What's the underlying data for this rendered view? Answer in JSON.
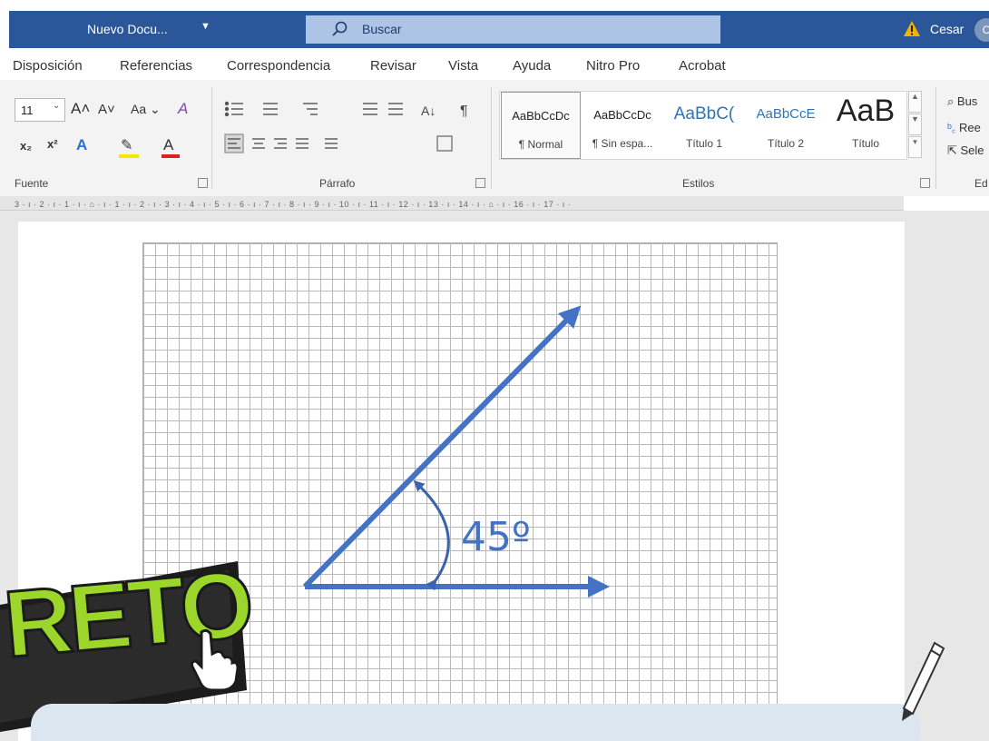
{
  "titlebar": {
    "document_title": "Nuevo Docu...",
    "search_placeholder": "Buscar",
    "user_name": "Cesar",
    "avatar_initial": "C"
  },
  "menu_tabs": [
    "Disposición",
    "Referencias",
    "Correspondencia",
    "Revisar",
    "Vista",
    "Ayuda",
    "Nitro Pro",
    "Acrobat"
  ],
  "ribbon": {
    "font_size": "11",
    "groups": {
      "font": "Fuente",
      "paragraph": "Párrafo",
      "styles": "Estilos",
      "editing": "Ed"
    },
    "styles": [
      {
        "sample": "AaBbCcDc",
        "name": "¶ Normal"
      },
      {
        "sample": "AaBbCcDc",
        "name": "¶ Sin espa..."
      },
      {
        "sample": "AaBbC(",
        "name": "Título 1"
      },
      {
        "sample": "AaBbCcE",
        "name": "Título 2"
      },
      {
        "sample": "AaB",
        "name": "Título"
      }
    ],
    "editing": {
      "find": "Bus",
      "replace": "Ree",
      "select": "Sele"
    }
  },
  "ruler": {
    "marks": "3 · ı · 2 · ı · 1 · ı · ⌂ · ı · 1 · ı · 2 · ı · 3 · ı · 4 · ı · 5 · ı · 6 · ı · 7 · ı · 8 · ı · 9 · ı · 10 · ı · 11 · ı · 12 · ı · 13 · ı · 14 · ı · ⌂ · ı · 16 · ı · 17 · ı ·"
  },
  "document": {
    "angle_label": "45º",
    "arrow_color": "#4472c4"
  },
  "overlay": {
    "badge_text": "RETO",
    "badge_color": "#9cd62a"
  },
  "colors": {
    "title_bar": "#2b579a",
    "search_box": "#aec4e6",
    "bubble": "#dbe6f1"
  },
  "icons": [
    "search-icon",
    "warning-icon",
    "cursor-hand-icon",
    "pencil-icon"
  ]
}
